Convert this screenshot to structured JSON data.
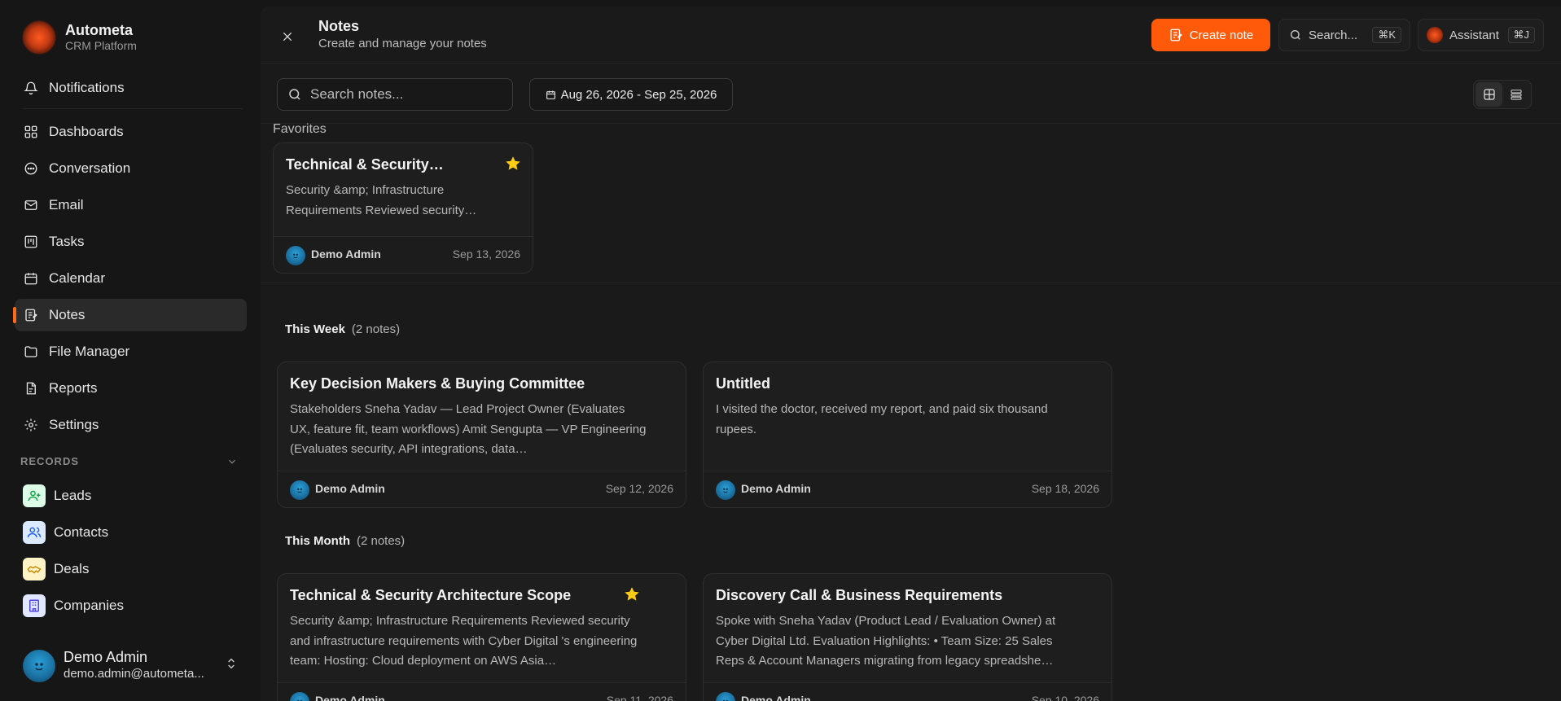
{
  "brand": {
    "name": "Autometa",
    "subtitle": "CRM Platform"
  },
  "sidebar": {
    "notifications": "Notifications",
    "items": [
      {
        "label": "Dashboards",
        "icon": "grid-icon"
      },
      {
        "label": "Conversation",
        "icon": "chat-icon"
      },
      {
        "label": "Email",
        "icon": "mail-icon"
      },
      {
        "label": "Tasks",
        "icon": "tasks-icon"
      },
      {
        "label": "Calendar",
        "icon": "calendar-icon"
      },
      {
        "label": "Notes",
        "icon": "notes-icon",
        "active": true
      },
      {
        "label": "File Manager",
        "icon": "folder-icon"
      },
      {
        "label": "Reports",
        "icon": "reports-icon"
      },
      {
        "label": "Settings",
        "icon": "gear-icon"
      }
    ],
    "records_label": "RECORDS",
    "records": [
      {
        "label": "Leads",
        "icon": "user-plus-icon",
        "color": "#22c55e"
      },
      {
        "label": "Contacts",
        "icon": "users-icon",
        "color": "#3b82f6"
      },
      {
        "label": "Deals",
        "icon": "handshake-icon",
        "color": "#eab308"
      },
      {
        "label": "Companies",
        "icon": "building-icon",
        "color": "#6366f1"
      }
    ],
    "user": {
      "name": "Demo Admin",
      "email": "demo.admin@autometa..."
    }
  },
  "header": {
    "title": "Notes",
    "subtitle": "Create and manage your notes",
    "create_label": "Create note",
    "search_label": "Search...",
    "search_kbd": "⌘K",
    "assistant_label": "Assistant",
    "assistant_kbd": "⌘J",
    "accent": "#ff5a0a"
  },
  "filters": {
    "search_placeholder": "Search notes...",
    "date_range": "Aug 26, 2026 - Sep 25, 2026"
  },
  "favorites": {
    "label": "Favorites",
    "cards": [
      {
        "title": "Technical & Security…",
        "body": "Security &amp; Infrastructure Requirements Reviewed security…",
        "author": "Demo Admin",
        "date": "Sep 13, 2026",
        "starred": true
      }
    ]
  },
  "groups": [
    {
      "label": "This Week",
      "count": "(2 notes)",
      "cards": [
        {
          "title": "Key Decision Makers & Buying Committee",
          "body": "Stakeholders Sneha Yadav — Lead Project Owner (Evaluates UX, feature fit, team workflows) Amit Sengupta — VP Engineering (Evaluates security, API integrations, data…",
          "author": "Demo Admin",
          "date": "Sep 12, 2026",
          "starred": false
        },
        {
          "title": "Untitled",
          "body": "I visited the doctor, received my report, and paid six thousand rupees.",
          "author": "Demo Admin",
          "date": "Sep 18, 2026",
          "starred": false
        }
      ]
    },
    {
      "label": "This Month",
      "count": "(2 notes)",
      "cards": [
        {
          "title": "Technical & Security Architecture Scope",
          "body": "Security &amp; Infrastructure Requirements Reviewed security and infrastructure requirements with Cyber Digital 's engineering team: Hosting: Cloud deployment on AWS Asia…",
          "author": "Demo Admin",
          "date": "Sep 11, 2026",
          "starred": true
        },
        {
          "title": "Discovery Call & Business Requirements",
          "body": "Spoke with Sneha Yadav (Product Lead / Evaluation Owner) at Cyber Digital Ltd. Evaluation Highlights: • Team Size: 25 Sales Reps & Account Managers migrating from legacy spreadshe…",
          "author": "Demo Admin",
          "date": "Sep 10, 2026",
          "starred": false
        }
      ]
    }
  ]
}
